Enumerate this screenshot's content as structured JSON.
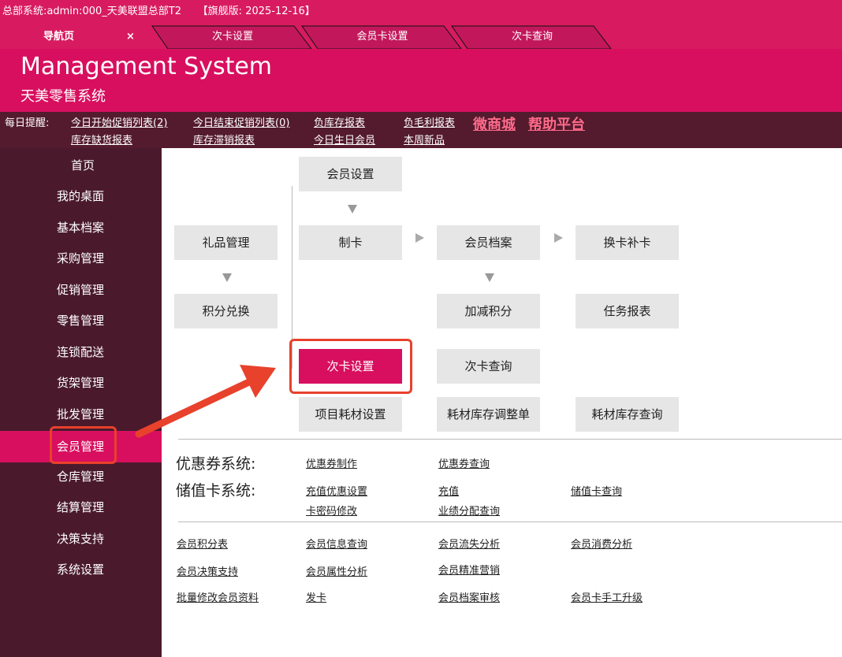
{
  "topbar": {
    "text": "总部系统:admin:000_天美联盟总部T2     【旗舰版: 2025-12-16】"
  },
  "tabs": [
    {
      "label": "导航页",
      "close": "×"
    },
    {
      "label": "次卡设置"
    },
    {
      "label": "会员卡设置"
    },
    {
      "label": "次卡查询"
    }
  ],
  "header": {
    "title": "Management System",
    "subtitle": "天美零售系统"
  },
  "reminders": {
    "label": "每日提醒:",
    "links": [
      "今日开始促销列表(2)",
      "今日结束促销列表(0)",
      "负库存报表",
      "负毛利报表",
      "库存缺货报表",
      "库存滞销报表",
      "今日生日会员",
      "本周新品"
    ],
    "featured": [
      "微商城",
      "帮助平台"
    ]
  },
  "sidebar": {
    "items": [
      "首页",
      "我的桌面",
      "基本档案",
      "采购管理",
      "促销管理",
      "零售管理",
      "连锁配送",
      "货架管理",
      "批发管理",
      "会员管理",
      "仓库管理",
      "结算管理",
      "决策支持",
      "系统设置"
    ],
    "active_index": 9
  },
  "flow": {
    "member_settings": "会员设置",
    "gift_management": "礼品管理",
    "make_card": "制卡",
    "member_archive": "会员档案",
    "replace_card": "换卡补卡",
    "points_exchange": "积分兑换",
    "adjust_points": "加减积分",
    "task_report": "任务报表",
    "count_card_settings": "次卡设置",
    "count_card_query": "次卡查询",
    "material_settings": "项目耗材设置",
    "material_adjust": "耗材库存调整单",
    "material_query": "耗材库存查询"
  },
  "coupon_system": {
    "label": "优惠券系统:",
    "links": [
      "优惠券制作",
      "优惠券查询"
    ]
  },
  "stored_card_system": {
    "label": "储值卡系统:",
    "links": [
      "充值优惠设置",
      "充值",
      "储值卡查询",
      "卡密码修改",
      "业绩分配查询"
    ]
  },
  "member_links": [
    "会员积分表",
    "会员信息查询",
    "会员流失分析",
    "会员消费分析",
    "会员决策支持",
    "会员属性分析",
    "会员精准营销",
    "批量修改会员资料",
    "发卡",
    "会员档案审核",
    "会员卡手工升级"
  ],
  "colors": {
    "primary": "#d80f5f",
    "sidebar": "#4a1a2c",
    "reminder_bar": "#541a2e",
    "highlight_border": "#e8412c"
  }
}
